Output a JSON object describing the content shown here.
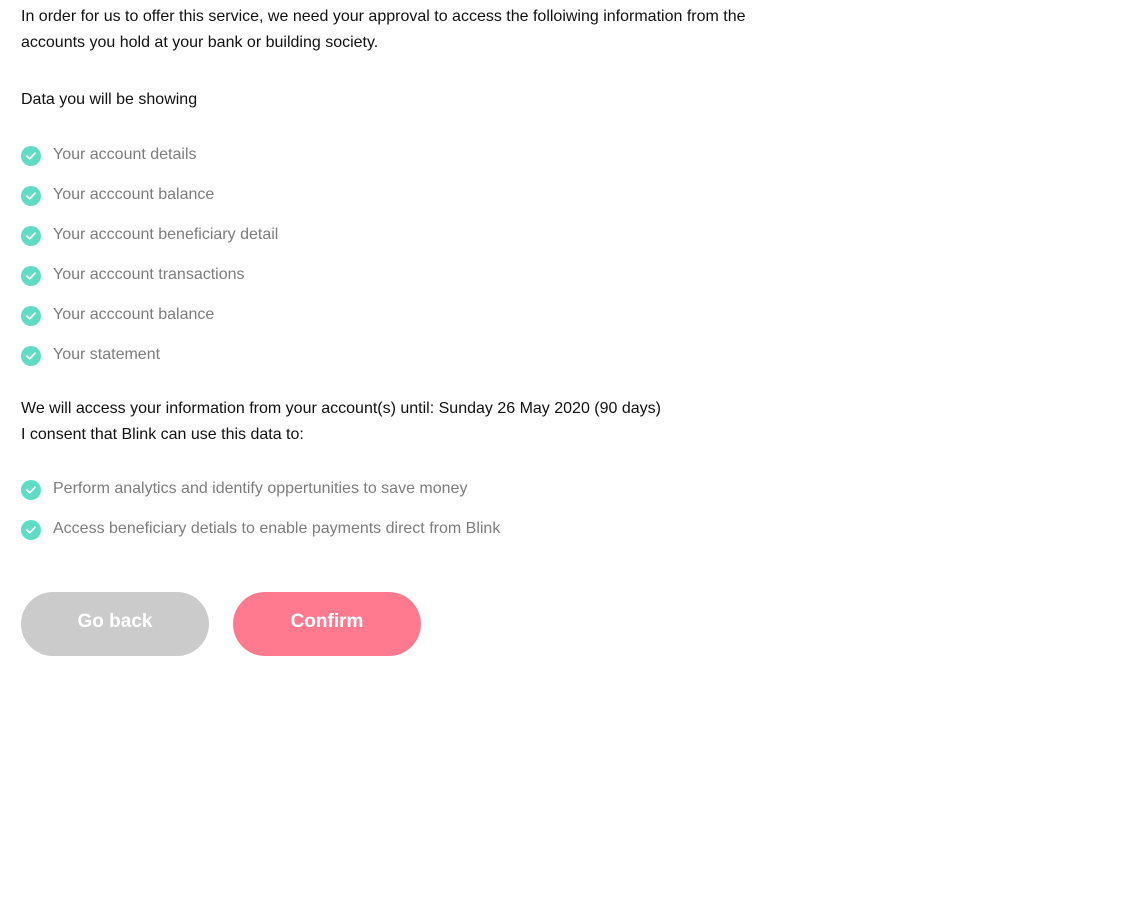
{
  "colors": {
    "check_accent": "#5fddc2",
    "back_button": "#cbcbcb",
    "confirm_button": "#ff7a8f",
    "muted_text": "#7d7d7d"
  },
  "intro": {
    "text": "In order for us to offer this service, we need your approval to access the folloiwing information from the accounts you hold at your bank or building society."
  },
  "data_section": {
    "title": "Data you will be showing",
    "icon": "check-circle-icon",
    "items": [
      "Your account details",
      "Your acccount balance",
      "Your acccount beneficiary detail",
      "Your acccount transactions",
      "Your acccount balance",
      "Your statement"
    ]
  },
  "access": {
    "until_text": "We will access your information from your account(s) until: Sunday 26 May 2020 (90 days)",
    "consent_text": "I consent that Blink can use this data to:"
  },
  "purposes": {
    "icon": "check-circle-icon",
    "items": [
      "Perform analytics and identify oppertunities to save money",
      "Access beneficiary detials to enable payments direct from Blink"
    ]
  },
  "actions": {
    "back_label": "Go back",
    "confirm_label": "Confirm"
  }
}
